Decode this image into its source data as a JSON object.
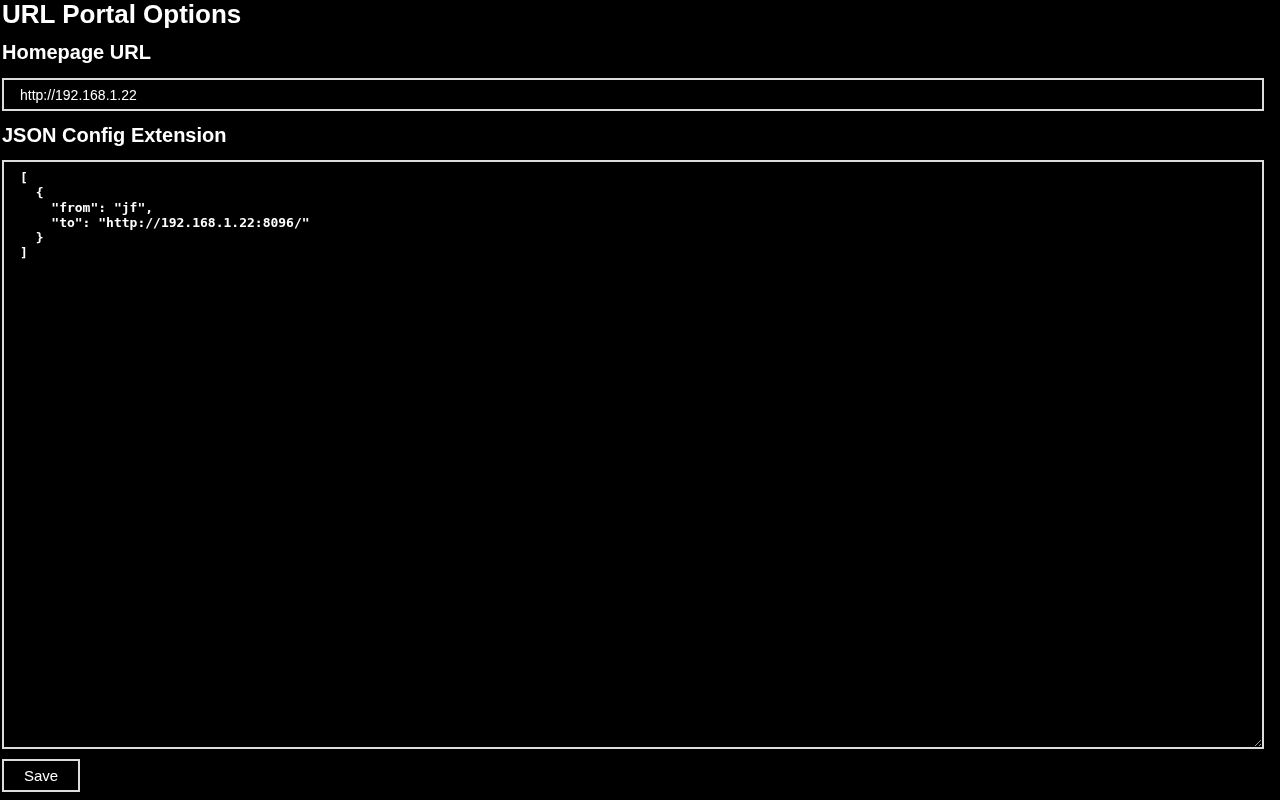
{
  "title": "URL Portal Options",
  "homepage": {
    "label": "Homepage URL",
    "value": "http://192.168.1.22"
  },
  "config": {
    "label": "JSON Config Extension",
    "value": "[\n  {\n    \"from\": \"jf\",\n    \"to\": \"http://192.168.1.22:8096/\"\n  }\n]"
  },
  "buttons": [
    "Save"
  ]
}
